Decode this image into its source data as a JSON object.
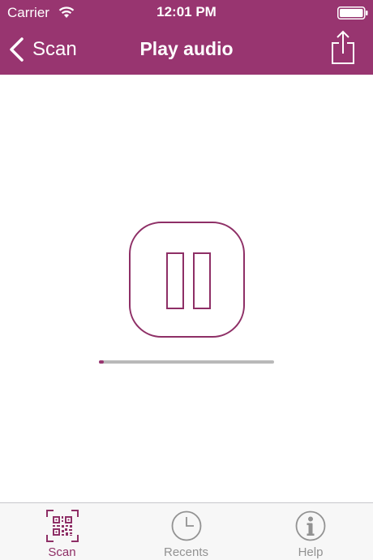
{
  "status_bar": {
    "carrier": "Carrier",
    "time": "12:01 PM"
  },
  "nav": {
    "back_label": "Scan",
    "title": "Play audio"
  },
  "player": {
    "state": "playing",
    "progress": 0.03
  },
  "tabs": [
    {
      "label": "Scan",
      "icon": "qr-code-icon",
      "active": true
    },
    {
      "label": "Recents",
      "icon": "clock-icon",
      "active": false
    },
    {
      "label": "Help",
      "icon": "info-icon",
      "active": false
    }
  ],
  "colors": {
    "brand": "#983570",
    "tab_active": "#8e2f66",
    "tab_inactive": "#929292",
    "track": "#b9b9b9"
  }
}
